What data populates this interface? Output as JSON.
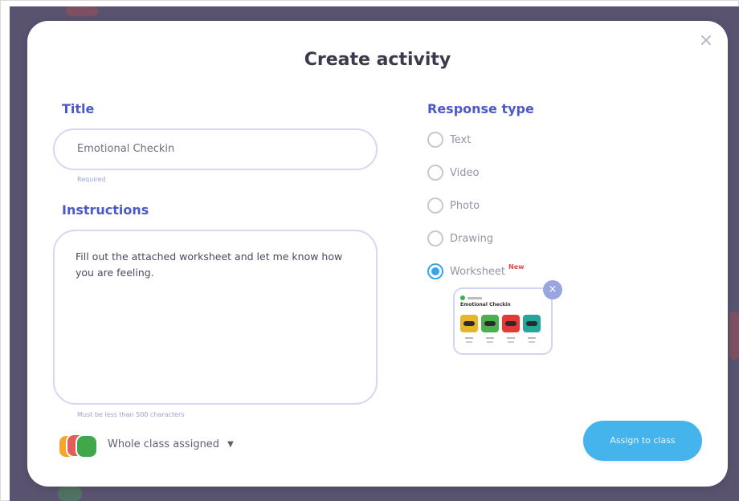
{
  "modal": {
    "title": "Create activity",
    "close_icon": "close-icon",
    "title_field": {
      "label": "Title",
      "value": "Emotional Checkin",
      "hint": "Required"
    },
    "instructions_field": {
      "label": "Instructions",
      "value": "Fill out the attached worksheet and let me know how you are feeling.",
      "hint": "Must be less than 500 characters"
    },
    "response_type": {
      "label": "Response type",
      "options": [
        {
          "label": "Text",
          "selected": false
        },
        {
          "label": "Video",
          "selected": false
        },
        {
          "label": "Photo",
          "selected": false
        },
        {
          "label": "Drawing",
          "selected": false
        },
        {
          "label": "Worksheet",
          "selected": true,
          "badge": "New"
        }
      ]
    },
    "worksheet_preview": {
      "title": "Emotional Checkin",
      "remove_icon": "close-icon",
      "face_colors": [
        "#e8b42a",
        "#4caf50",
        "#e53935",
        "#26a69a"
      ]
    },
    "assignment": {
      "label": "Whole class assigned",
      "avatar_colors": [
        "#f4a52a",
        "#e35d5d",
        "#3fa84a"
      ]
    },
    "assign_button": "Assign to class",
    "colors": {
      "accent": "#4b5ac8",
      "primary_button": "#45b4ec",
      "selected_radio": "#36a3ea"
    }
  }
}
